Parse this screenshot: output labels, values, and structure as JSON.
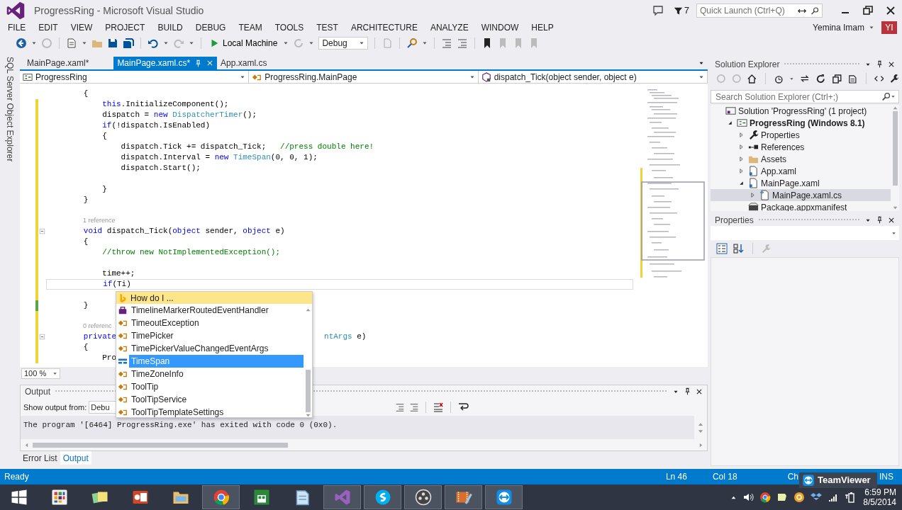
{
  "window": {
    "title": "ProgressRing - Microsoft Visual Studio"
  },
  "notifications": {
    "count": "7"
  },
  "quick_launch": {
    "placeholder": "Quick Launch (Ctrl+Q)"
  },
  "menu": [
    "FILE",
    "EDIT",
    "VIEW",
    "PROJECT",
    "BUILD",
    "DEBUG",
    "TEAM",
    "TOOLS",
    "TEST",
    "ARCHITECTURE",
    "ANALYZE",
    "WINDOW",
    "HELP"
  ],
  "user": {
    "name": "Yemina Imam",
    "initials": "YI"
  },
  "toolbar": {
    "target": "Local Machine",
    "configuration": "Debug"
  },
  "side_tab": "SQL Server Object Explorer",
  "doc_tabs": [
    {
      "label": "MainPage.xaml*",
      "selected": false
    },
    {
      "label": "MainPage.xaml.cs*",
      "selected": true
    },
    {
      "label": "App.xaml.cs",
      "selected": false
    }
  ],
  "nav_bar": [
    "ProgressRing",
    "ProgressRing.MainPage",
    "dispatch_Tick(object sender, object e)"
  ],
  "code_lines": [
    {
      "kind": "code",
      "collapsible": false,
      "current": false,
      "segments": [
        {
          "text": "        {",
          "kind": "plain"
        }
      ]
    },
    {
      "kind": "code",
      "color": "#efd437",
      "collapsible": false,
      "current": false,
      "segments": [
        {
          "text": "            this",
          "kind": "keyword"
        },
        {
          "text": ".InitializeComponent();",
          "kind": "plain"
        }
      ]
    },
    {
      "kind": "code",
      "color": "#efd437",
      "collapsible": false,
      "current": false,
      "segments": [
        {
          "text": "            dispatch = ",
          "kind": "plain"
        },
        {
          "text": "new ",
          "kind": "keyword"
        },
        {
          "text": "DispatcherTimer",
          "kind": "type"
        },
        {
          "text": "();",
          "kind": "plain"
        }
      ]
    },
    {
      "kind": "code",
      "color": "#efd437",
      "collapsible": false,
      "current": false,
      "segments": [
        {
          "text": "            if",
          "kind": "keyword"
        },
        {
          "text": "(!dispatch.IsEnabled)",
          "kind": "plain"
        }
      ]
    },
    {
      "kind": "code",
      "color": "#efd437",
      "collapsible": false,
      "current": false,
      "segments": [
        {
          "text": "            {",
          "kind": "plain"
        }
      ]
    },
    {
      "kind": "code",
      "color": "#efd437",
      "collapsible": false,
      "current": false,
      "segments": [
        {
          "text": "                dispatch.Tick += dispatch_Tick;   ",
          "kind": "plain"
        },
        {
          "text": "//press double here!",
          "kind": "comment"
        }
      ]
    },
    {
      "kind": "code",
      "color": "#efd437",
      "collapsible": false,
      "current": false,
      "segments": [
        {
          "text": "                dispatch.Interval = ",
          "kind": "plain"
        },
        {
          "text": "new ",
          "kind": "keyword"
        },
        {
          "text": "TimeSpan",
          "kind": "type"
        },
        {
          "text": "(0, 0, 1);",
          "kind": "plain"
        }
      ]
    },
    {
      "kind": "code",
      "color": "#efd437",
      "collapsible": false,
      "current": false,
      "segments": [
        {
          "text": "                dispatch.Start();",
          "kind": "plain"
        }
      ]
    },
    {
      "kind": "blank",
      "color": "#efd437",
      "collapsible": false,
      "current": false
    },
    {
      "kind": "code",
      "color": "#efd437",
      "collapsible": false,
      "current": false,
      "segments": [
        {
          "text": "            }",
          "kind": "plain"
        }
      ]
    },
    {
      "kind": "code",
      "color": "#efd437",
      "collapsible": false,
      "current": false,
      "segments": [
        {
          "text": "        }",
          "kind": "plain"
        }
      ]
    },
    {
      "kind": "blank",
      "color": "#efd437",
      "collapsible": false,
      "current": false
    },
    {
      "kind": "lens",
      "color": "#efd437",
      "collapsible": false,
      "current": false,
      "text": "1 reference"
    },
    {
      "kind": "code",
      "color": "#efd437",
      "collapsible": true,
      "current": false,
      "segments": [
        {
          "text": "        void",
          "kind": "keyword"
        },
        {
          "text": " dispatch_Tick(",
          "kind": "plain"
        },
        {
          "text": "object",
          "kind": "keyword"
        },
        {
          "text": " sender, ",
          "kind": "plain"
        },
        {
          "text": "object",
          "kind": "keyword"
        },
        {
          "text": " e)",
          "kind": "plain"
        }
      ]
    },
    {
      "kind": "code",
      "color": "#efd437",
      "collapsible": false,
      "current": false,
      "segments": [
        {
          "text": "        {",
          "kind": "plain"
        }
      ]
    },
    {
      "kind": "code",
      "color": "#efd437",
      "collapsible": false,
      "current": false,
      "segments": [
        {
          "text": "            //throw new NotImplementedException();",
          "kind": "comment"
        }
      ]
    },
    {
      "kind": "blank",
      "color": "#efd437",
      "collapsible": false,
      "current": false
    },
    {
      "kind": "code",
      "color": "#efd437",
      "collapsible": false,
      "current": false,
      "segments": [
        {
          "text": "            time++;",
          "kind": "plain"
        }
      ]
    },
    {
      "kind": "code",
      "color": "#efd437",
      "collapsible": false,
      "current": true,
      "segments": [
        {
          "text": "            if",
          "kind": "keyword"
        },
        {
          "text": "(Ti)",
          "kind": "plain"
        }
      ]
    },
    {
      "kind": "blank",
      "color": "#efd437",
      "collapsible": false,
      "current": false
    },
    {
      "kind": "code",
      "color": "#57a64a",
      "collapsible": false,
      "current": false,
      "segments": [
        {
          "text": "        }",
          "kind": "plain"
        }
      ]
    },
    {
      "kind": "blank",
      "color": "#efd437",
      "collapsible": false,
      "current": false
    },
    {
      "kind": "lens",
      "color": "#efd437",
      "collapsible": false,
      "current": false,
      "text": "0 referenc"
    },
    {
      "kind": "code",
      "color": "#efd437",
      "collapsible": true,
      "current": false,
      "segments": [
        {
          "text": "        private",
          "kind": "keyword"
        }
      ],
      "tail": [
        {
          "text": "ntArgs",
          "kind": "type"
        },
        {
          "text": " e)",
          "kind": "plain"
        }
      ]
    },
    {
      "kind": "code",
      "color": "#efd437",
      "collapsible": false,
      "current": false,
      "segments": [
        {
          "text": "        {",
          "kind": "plain"
        }
      ]
    },
    {
      "kind": "code",
      "color": "#efd437",
      "collapsible": false,
      "current": false,
      "segments": [
        {
          "text": "            Pro",
          "kind": "plain"
        }
      ]
    }
  ],
  "completion": {
    "header": "How do I ...",
    "items": [
      {
        "label": "TimelineMarkerRoutedEventHandler",
        "kind": "delegate",
        "selected": false
      },
      {
        "label": "TimeoutException",
        "kind": "class",
        "selected": false
      },
      {
        "label": "TimePicker",
        "kind": "class",
        "selected": false
      },
      {
        "label": "TimePickerValueChangedEventArgs",
        "kind": "class",
        "selected": false
      },
      {
        "label": "TimeSpan",
        "kind": "struct",
        "selected": true
      },
      {
        "label": "TimeZoneInfo",
        "kind": "class",
        "selected": false
      },
      {
        "label": "ToolTip",
        "kind": "class",
        "selected": false
      },
      {
        "label": "ToolTipService",
        "kind": "class",
        "selected": false
      },
      {
        "label": "ToolTipTemplateSettings",
        "kind": "class",
        "selected": false
      }
    ]
  },
  "zoom": "100 %",
  "output": {
    "title": "Output",
    "source_label": "Show output from:",
    "source": "Debu",
    "lines": [
      "The program '[6464] ProgressRing.exe' has exited with code 0 (0x0)."
    ]
  },
  "bottom_tabs": [
    {
      "label": "Error List",
      "selected": false
    },
    {
      "label": "Output",
      "selected": true
    }
  ],
  "solution_explorer": {
    "title": "Solution Explorer",
    "search_placeholder": "Search Solution Explorer (Ctrl+;)",
    "tree": [
      {
        "label": "Solution 'ProgressRing' (1 project)",
        "kind": "solution",
        "selected": false,
        "children": [
          {
            "label": "ProgressRing (Windows 8.1)",
            "kind": "project",
            "expanded": true,
            "selected": false,
            "children": [
              {
                "label": "Properties",
                "kind": "properties",
                "expanded": false,
                "selected": false
              },
              {
                "label": "References",
                "kind": "references",
                "expanded": false,
                "selected": false
              },
              {
                "label": "Assets",
                "kind": "folder",
                "expanded": false,
                "selected": false
              },
              {
                "label": "App.xaml",
                "kind": "xaml",
                "expanded": false,
                "selected": false
              },
              {
                "label": "MainPage.xaml",
                "kind": "xaml",
                "expanded": true,
                "selected": false,
                "children": [
                  {
                    "label": "MainPage.xaml.cs",
                    "kind": "cs",
                    "expanded": false,
                    "selected": true
                  }
                ]
              },
              {
                "label": "Package.appxmanifest",
                "kind": "manifest",
                "selected": false
              }
            ]
          }
        ]
      }
    ]
  },
  "properties": {
    "title": "Properties"
  },
  "status_bar": {
    "message": "Ready",
    "line": "Ln 46",
    "column": "Col 18",
    "char": "Ch",
    "mode": "INS"
  },
  "notification_badge": "TeamViewer",
  "taskbar": {
    "apps": [
      {
        "kind": "start",
        "running": false
      },
      {
        "kind": "apps",
        "running": false
      },
      {
        "kind": "photos",
        "running": false
      },
      {
        "kind": "slides",
        "running": false
      },
      {
        "kind": "explorer",
        "running": false
      },
      {
        "kind": "browser",
        "running": true
      },
      {
        "kind": "store",
        "running": false
      },
      {
        "kind": "notepad",
        "running": false
      },
      {
        "kind": "ide",
        "running": true
      },
      {
        "kind": "chat",
        "running": true
      },
      {
        "kind": "media",
        "running": true
      },
      {
        "kind": "video",
        "running": true
      },
      {
        "kind": "remote",
        "running": true
      }
    ],
    "time": "6:59 PM",
    "date": "8/5/2014"
  }
}
